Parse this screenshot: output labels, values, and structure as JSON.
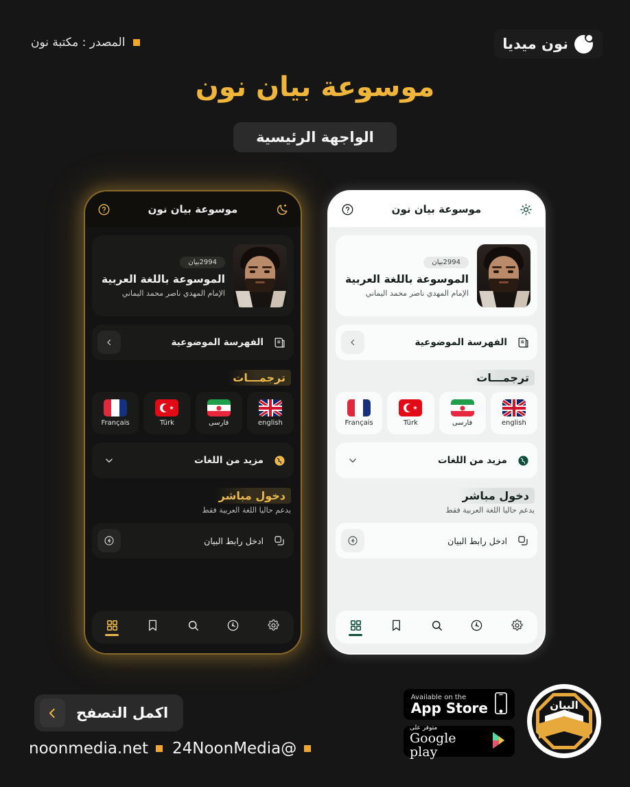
{
  "header": {
    "brand_name": "نون ميديا",
    "brand_icon": "crescent-moon-icon",
    "source_text": "المصدر : مكتبة نون"
  },
  "hero": {
    "title": "موسوعة بيان نون",
    "subtitle_badge": "الواجهة الرئيسية"
  },
  "colors": {
    "gold": "#f0b63c",
    "gold_dim": "#ecb94e",
    "page_bg": "#161616",
    "light_accent": "#0f4d3a"
  },
  "app": {
    "header": {
      "title": "موسوعة بيان نون",
      "theme_icon_dark": "moon-icon",
      "theme_icon_light": "sun-icon",
      "help_icon": "question-circle-icon"
    },
    "hero_card": {
      "badge": "2994بيان",
      "title": "الموسوعة باللغة العربية",
      "subtitle": "الإمام المهدي ناصر محمد اليماني",
      "avatar_name": "avatar"
    },
    "index_row": {
      "label": "الفهرسة الموضوعية",
      "icon": "book-index-icon",
      "action_icon": "chevron-left-icon"
    },
    "translations": {
      "heading": "ترجمـــات",
      "languages": [
        {
          "label": "english",
          "flag": "flag-uk"
        },
        {
          "label": "فارسی",
          "flag": "flag-iran"
        },
        {
          "label": "Türk",
          "flag": "flag-turkey"
        },
        {
          "label": "Français",
          "flag": "flag-france"
        }
      ],
      "more_label": "مزيد من اللغات",
      "more_icon": "globe-icon",
      "more_action_icon": "chevron-down-icon"
    },
    "direct_entry": {
      "heading": "دخول مباشر",
      "note": "يدعم حاليا اللغة العربية فقط",
      "input_label": "ادخل رابط البيان",
      "input_icon": "link-copy-icon",
      "submit_icon": "arrow-left-circle-icon"
    },
    "nav": [
      {
        "icon": "grid-icon",
        "active": true
      },
      {
        "icon": "bookmark-icon",
        "active": false
      },
      {
        "icon": "search-icon",
        "active": false
      },
      {
        "icon": "history-icon",
        "active": false
      },
      {
        "icon": "gear-icon",
        "active": false
      }
    ]
  },
  "footer": {
    "cta_label": "اكمل التصفح",
    "cta_icon": "chevron-left-icon",
    "social_handle": "@24NoonMedia",
    "website": "noonmedia.net",
    "appstore": {
      "line1": "Available on the",
      "line2": "App Store"
    },
    "googleplay": {
      "line1": "متوفر على",
      "line2": "Google play"
    },
    "seal_text": "البيان"
  }
}
